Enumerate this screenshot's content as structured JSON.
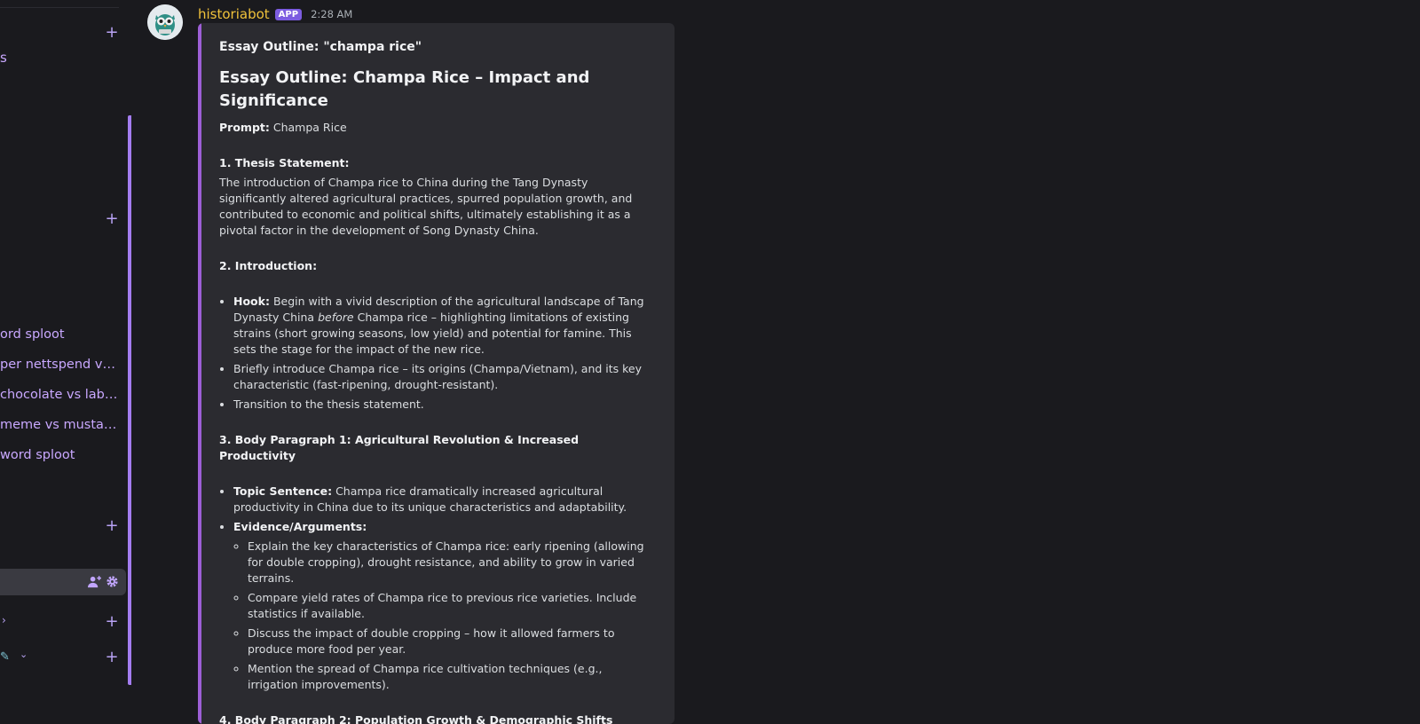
{
  "sidebar": {
    "top_fragment": "s",
    "threads": [
      "ord sploot",
      "per nettspend vs ...",
      "chocolate vs labu...",
      "meme vs mustard...",
      "word sploot"
    ],
    "active_item_icons": [
      "add-member-icon",
      "gear-icon"
    ],
    "chevron": "›",
    "emoji_chevron": "⌄"
  },
  "message": {
    "username": "historiabot",
    "badge": "APP",
    "timestamp": "2:28 AM",
    "embed": {
      "title": "Essay Outline: \"champa rice\"",
      "heading": "Essay Outline: Champa Rice – Impact and Significance",
      "prompt_label": "Prompt:",
      "prompt_value": "Champa Rice",
      "sections": {
        "thesis": {
          "heading": "1. Thesis Statement:",
          "text": "The introduction of Champa rice to China during the Tang Dynasty significantly altered agricultural practices, spurred population growth, and contributed to economic and political shifts, ultimately establishing it as a pivotal factor in the development of Song Dynasty China."
        },
        "intro": {
          "heading": "2. Introduction:",
          "hook_label": "Hook:",
          "hook_text_a": "Begin with a vivid description of the agricultural landscape of Tang Dynasty China",
          "hook_italic": "before",
          "hook_text_b": "Champa rice – highlighting limitations of existing strains (short growing seasons, low yield) and potential for famine. This sets the stage for the impact of the new rice.",
          "bullet2": "Briefly introduce Champa rice – its origins (Champa/Vietnam), and its key characteristic (fast-ripening, drought-resistant).",
          "bullet3": "Transition to the thesis statement."
        },
        "body1": {
          "heading": "3. Body Paragraph 1: Agricultural Revolution & Increased Productivity",
          "topic_label": "Topic Sentence:",
          "topic_text": "Champa rice dramatically increased agricultural productivity in China due to its unique characteristics and adaptability.",
          "evidence_label": "Evidence/Arguments:",
          "evidence": [
            "Explain the key characteristics of Champa rice: early ripening (allowing for double cropping), drought resistance, and ability to grow in varied terrains.",
            "Compare yield rates of Champa rice to previous rice varieties. Include statistics if available.",
            "Discuss the impact of double cropping – how it allowed farmers to produce more food per year.",
            "Mention the spread of Champa rice cultivation techniques (e.g., irrigation improvements)."
          ]
        },
        "body2": {
          "heading": "4. Body Paragraph 2: Population Growth & Demographic Shifts"
        }
      }
    }
  },
  "colors": {
    "accent": "#9d5fd6",
    "username": "#f0c23b",
    "thread_link": "#c9a8ff"
  }
}
